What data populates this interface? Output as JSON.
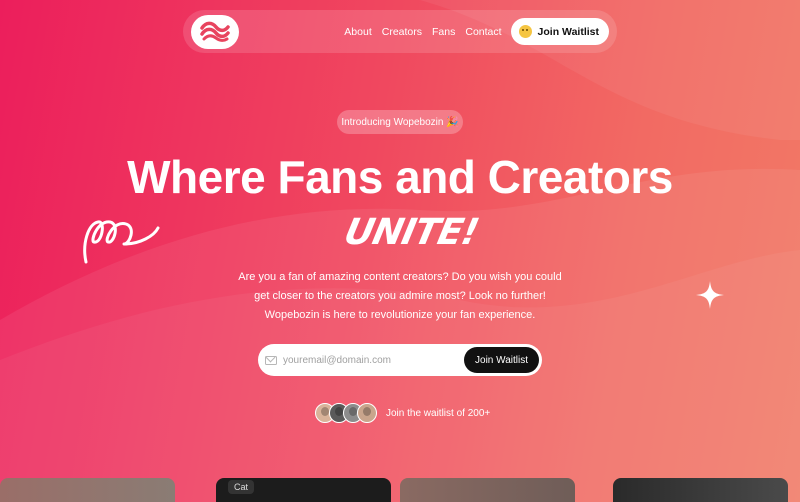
{
  "nav": {
    "logo": "wopebozin-logo",
    "links": [
      "About",
      "Creators",
      "Fans",
      "Contact"
    ],
    "cta_label": "Join Waitlist"
  },
  "hero": {
    "badge": "Introducing Wopebozin 🎉",
    "headline": "Where Fans and Creators",
    "script_word": "UNITE!",
    "description": "Are you a fan of amazing content creators? Do you wish you could get closer to the creators you admire most? Look no further! Wopebozin is here to revolutionize your fan experience."
  },
  "signup": {
    "placeholder": "youremail@domain.com",
    "button_label": "Join Waitlist"
  },
  "social_proof": {
    "text": "Join the waitlist of 200+"
  },
  "cards": {
    "card_2_label": "Cat"
  },
  "colors": {
    "accent_pink": "#ec1e5c",
    "accent_coral": "#f27a66",
    "button_dark": "#111111"
  }
}
